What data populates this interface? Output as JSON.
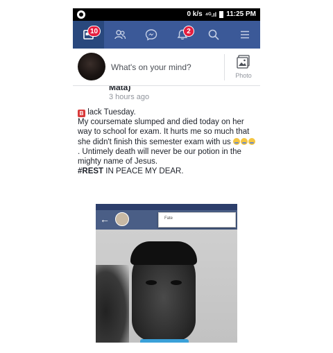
{
  "status_bar": {
    "data_rate": "0 k/s",
    "signal": "⁴ᴳ.ıl",
    "time": "11:25 PM"
  },
  "nav": {
    "home_badge": "10",
    "notifications_badge": "2",
    "accent_color": "#3b5998",
    "badge_color": "#e41e3f"
  },
  "composer": {
    "placeholder": "What's on your mind?",
    "photo_label": "Photo"
  },
  "post": {
    "author": "Mata)",
    "time": "3 hours ago",
    "line1": "lack Tuesday.",
    "line2": "My coursemate slumped and died today on her way to school for exam. It hurts me so much that she didn't finish this semester exam with us",
    "line3": ". Untimely death will never be our potion in the mighty name of Jesus.",
    "hashtag": "#REST",
    "line4": " IN PEACE MY DEAR."
  },
  "embedded_image": {
    "popup_text": "Fate"
  }
}
